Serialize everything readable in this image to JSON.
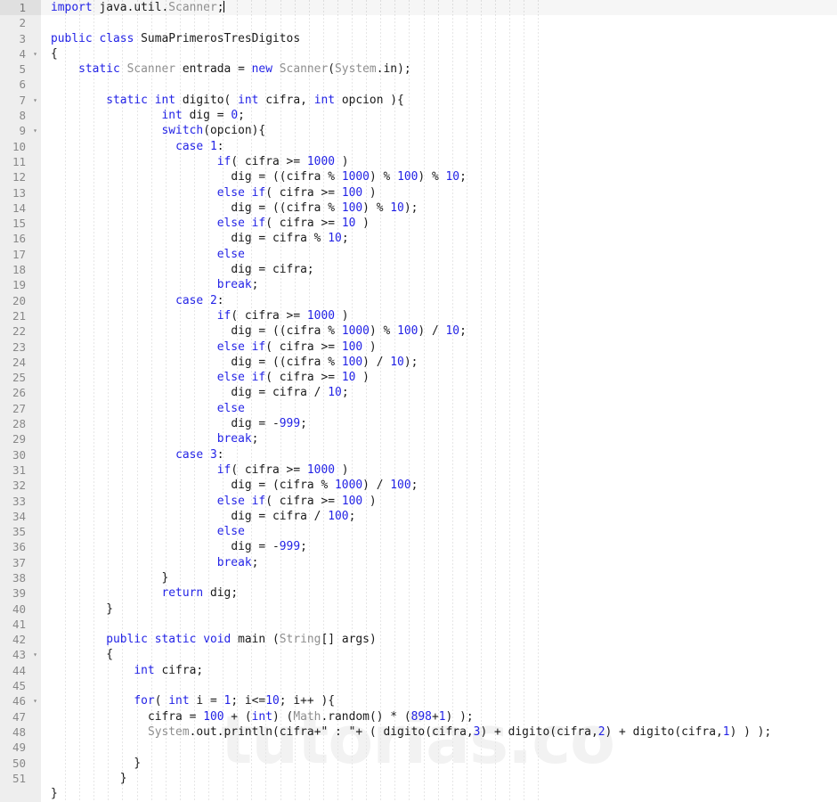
{
  "editor": {
    "language": "java",
    "file_title": "SumaPrimerosTresDigitos",
    "total_lines": 51,
    "active_line": 1,
    "gutter_active_bg": "#e0e0e0",
    "gutter_bg": "#eeeeee",
    "background": "#ffffff",
    "keyword_color": "#2323e6",
    "class_color": "#8e8e8e",
    "text_color": "#1a1a1a",
    "watermark": "tutorias.co",
    "watermark_color": "#f2f2f2",
    "fold_marker_glyph": "▾",
    "fold_lines": [
      4,
      7,
      9,
      43,
      46
    ]
  },
  "line_numbers": [
    "1",
    "2",
    "3",
    "4",
    "5",
    "6",
    "7",
    "8",
    "9",
    "10",
    "11",
    "12",
    "13",
    "14",
    "15",
    "16",
    "17",
    "18",
    "19",
    "20",
    "21",
    "22",
    "23",
    "24",
    "25",
    "26",
    "27",
    "28",
    "29",
    "30",
    "31",
    "32",
    "33",
    "34",
    "35",
    "36",
    "37",
    "38",
    "39",
    "40",
    "41",
    "42",
    "43",
    "44",
    "45",
    "46",
    "47",
    "48",
    "49",
    "50",
    "51"
  ],
  "code_lines": [
    "import java.util.Scanner;",
    "",
    "public class SumaPrimerosTresDigitos",
    "{",
    "    static Scanner entrada = new Scanner(System.in);",
    "",
    "        static int digito( int cifra, int opcion ){",
    "                int dig = 0;",
    "                switch(opcion){",
    "                  case 1:",
    "                        if( cifra >= 1000 )",
    "                          dig = ((cifra % 1000) % 100) % 10;",
    "                        else if( cifra >= 100 )",
    "                          dig = ((cifra % 100) % 10);",
    "                        else if( cifra >= 10 )",
    "                          dig = cifra % 10;",
    "                        else",
    "                          dig = cifra;",
    "                        break;",
    "                  case 2:",
    "                        if( cifra >= 1000 )",
    "                          dig = ((cifra % 1000) % 100) / 10;",
    "                        else if( cifra >= 100 )",
    "                          dig = ((cifra % 100) / 10);",
    "                        else if( cifra >= 10 )",
    "                          dig = cifra / 10;",
    "                        else",
    "                          dig = -999;",
    "                        break;",
    "                  case 3:",
    "                        if( cifra >= 1000 )",
    "                          dig = (cifra % 1000) / 100;",
    "                        else if( cifra >= 100 )",
    "                          dig = cifra / 100;",
    "                        else",
    "                          dig = -999;",
    "                        break;",
    "                }",
    "                return dig;",
    "        }",
    "",
    "        public static void main (String[] args)",
    "        {",
    "            int cifra;",
    "",
    "            for( int i = 1; i<=10; i++ ){",
    "              cifra = 100 + (int) (Math.random() * (898+1) );",
    "              System.out.println(cifra+\" : \"+ ( digito(cifra,3) + digito(cifra,2) + digito(cifra,1) ) );",
    "",
    "            }",
    "          }",
    "}"
  ],
  "tokens": {
    "keywords": [
      "import",
      "public",
      "class",
      "static",
      "new",
      "int",
      "switch",
      "case",
      "if",
      "else",
      "break",
      "return",
      "void",
      "for"
    ],
    "class_names": [
      "Scanner",
      "System",
      "String",
      "Math"
    ],
    "literals": [
      "0",
      "1",
      "2",
      "3",
      "10",
      "100",
      "1000",
      "999",
      "898",
      "in",
      "random",
      "out",
      "println"
    ]
  }
}
